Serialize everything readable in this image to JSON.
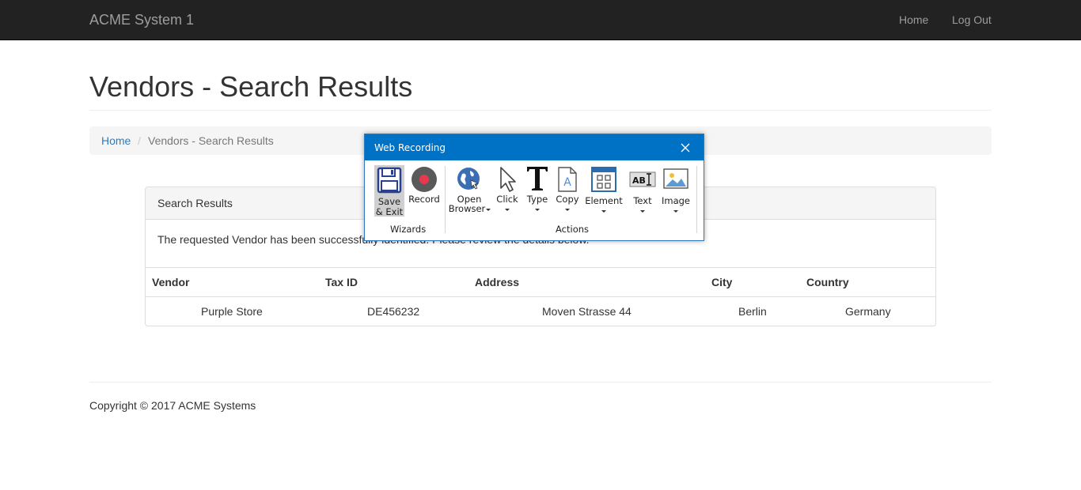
{
  "navbar": {
    "brand": "ACME System 1",
    "links": [
      "Home",
      "Log Out"
    ]
  },
  "page": {
    "title": "Vendors - Search Results"
  },
  "breadcrumb": {
    "home": "Home",
    "separator": "/",
    "current": "Vendors - Search Results"
  },
  "panel": {
    "title": "Search Results",
    "message": "The requested Vendor has been successfully identified. Please review the details below."
  },
  "table": {
    "headers": [
      "Vendor",
      "Tax ID",
      "Address",
      "City",
      "Country"
    ],
    "rows": [
      [
        "Purple Store",
        "DE456232",
        "Moven Strasse 44",
        "Berlin",
        "Germany"
      ]
    ]
  },
  "footer": {
    "copyright": "Copyright © 2017 ACME Systems"
  },
  "dialog": {
    "title": "Web Recording",
    "close_icon": "close-icon",
    "wizards": {
      "label": "Wizards",
      "save_line1": "Save",
      "save_line2": "& Exit",
      "record": "Record"
    },
    "actions": {
      "label": "Actions",
      "open_line1": "Open",
      "open_line2": "Browser",
      "click": "Click",
      "type": "Type",
      "copy": "Copy",
      "element": "Element",
      "text": "Text",
      "image": "Image"
    }
  },
  "colors": {
    "navbar_bg": "#222222",
    "link": "#337ab7",
    "dialog_titlebar": "#0072c6",
    "record_red": "#e8384f"
  }
}
